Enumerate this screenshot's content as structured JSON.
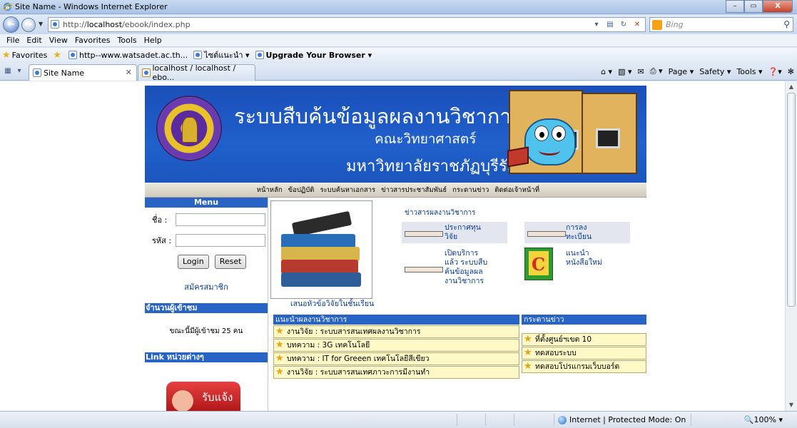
{
  "window": {
    "title": "Site Name - Windows Internet Explorer"
  },
  "address": {
    "url_prefix": "http://",
    "url_host": "localhost",
    "url_path": "/ebook/index.php"
  },
  "search": {
    "placeholder": "Bing"
  },
  "menu": [
    "File",
    "Edit",
    "View",
    "Favorites",
    "Tools",
    "Help"
  ],
  "favorites": {
    "label": "Favorites",
    "items": [
      "http--www.watsadet.ac.th...",
      "ไซต์แนะนำ ▾",
      "Upgrade Your Browser ▾"
    ]
  },
  "tabs": {
    "active": "Site Name",
    "inactive": "localhost / localhost / ebo..."
  },
  "commandbar": [
    "Page ▾",
    "Safety ▾",
    "Tools ▾"
  ],
  "banner": {
    "title": "ระบบสืบค้นข้อมูลผลงานวิชาการ",
    "faculty": "คณะวิทยาศาสตร์",
    "university": "มหาวิทยาลัยราชภัฏบุรีรัมย์"
  },
  "nav": [
    "หน้าหลัก",
    "ข้อปฏิบัติ",
    "ระบบค้นหาเอกสาร",
    "ข่าวสารประชาสัมพันธ์",
    "กระดานข่าว",
    "ติดต่อเจ้าหน้าที่"
  ],
  "login": {
    "heading": "Menu",
    "username_label": "ชื่อ :",
    "password_label": "รหัส :",
    "login_btn": "Login",
    "reset_btn": "Reset",
    "register": "สมัครสมาชิก"
  },
  "visitors": {
    "heading": "จำนวนผู้เข้าชม",
    "text": "ขณะนี้มีผู้เข้าชม 25 คน"
  },
  "links": {
    "heading": "Link หน่วยต่างๆ",
    "banner_text": "รับแจ้ง"
  },
  "main": {
    "image_caption": "เสนอหัวข้อวิจัยในชั้นเรียน",
    "news_title": "ข่าวสารผลงานวิชาการ",
    "news": [
      {
        "text_1": "ประกาศทุน",
        "text_2": "วิจัย"
      },
      {
        "text_1": "การลง",
        "text_2": "ทะเบียน"
      },
      {
        "text_1": "เปิดบริการ",
        "text_2": "แล้ว ระบบสืบ",
        "text_3": "ค้นข้อมูลผล",
        "text_4": "งานวิชาการ"
      },
      {
        "text_1": "แนะนำ",
        "text_2": "หนังสือใหม่"
      }
    ]
  },
  "recommend": {
    "heading": "แนะนำผลงานวิชาการ",
    "items": [
      "งานวิจัย : ระบบสารสนเทศผลงานวิชาการ",
      "บทความ : 3G เทคโนโลยี",
      "บทความ : IT for Greeen เทคโนโลยีสีเขียว",
      "งานวิจัย : ระบบสารสนเทศภาวะการมีงานทำ"
    ]
  },
  "board": {
    "heading": "กระดานข่าว",
    "items": [
      "ที่ตั้งศูนย์ฯเขต 10",
      "ทดสอบระบบ",
      "ทดสอบโปรแกรมเว็บบอร์ด"
    ]
  },
  "status": {
    "zone": "Internet | Protected Mode: On",
    "zoom": "🔍100% ▾"
  }
}
